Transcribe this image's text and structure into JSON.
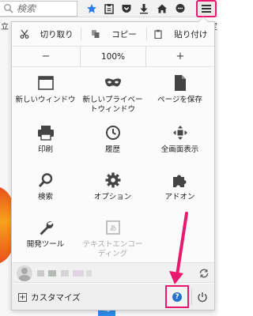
{
  "toolbar": {
    "search_placeholder": "検索",
    "icons": [
      "star-icon",
      "clipboard-icon",
      "pocket-icon",
      "download-icon",
      "home-icon",
      "chat-icon",
      "menu-icon"
    ]
  },
  "background": {
    "left_text": "立",
    "right_text": "定",
    "bottom_button": "→"
  },
  "panel": {
    "edit": {
      "cut": "切り取り",
      "copy": "コピー",
      "paste": "貼り付け"
    },
    "zoom": {
      "minus": "−",
      "value": "100%",
      "plus": "+"
    },
    "tiles": [
      {
        "label": "新しいウィンドウ",
        "icon": "new-window-icon"
      },
      {
        "label": "新しいプライベー\nトウィンドウ",
        "icon": "private-mask-icon"
      },
      {
        "label": "ページを保存",
        "icon": "save-page-icon"
      },
      {
        "label": "印刷",
        "icon": "print-icon"
      },
      {
        "label": "履歴",
        "icon": "history-clock-icon"
      },
      {
        "label": "全画面表示",
        "icon": "fullscreen-icon"
      },
      {
        "label": "検索",
        "icon": "search-icon"
      },
      {
        "label": "オプション",
        "icon": "gear-icon"
      },
      {
        "label": "アドオン",
        "icon": "puzzle-icon"
      },
      {
        "label": "開発ツール",
        "icon": "wrench-icon"
      },
      {
        "label": "テキストエンコー\nディング",
        "icon": "text-encoding-icon"
      }
    ],
    "footer": {
      "customize": "カスタマイズ",
      "help_glyph": "?"
    }
  },
  "colors": {
    "highlight": "#e8196e",
    "accent_blue": "#2570c9"
  }
}
